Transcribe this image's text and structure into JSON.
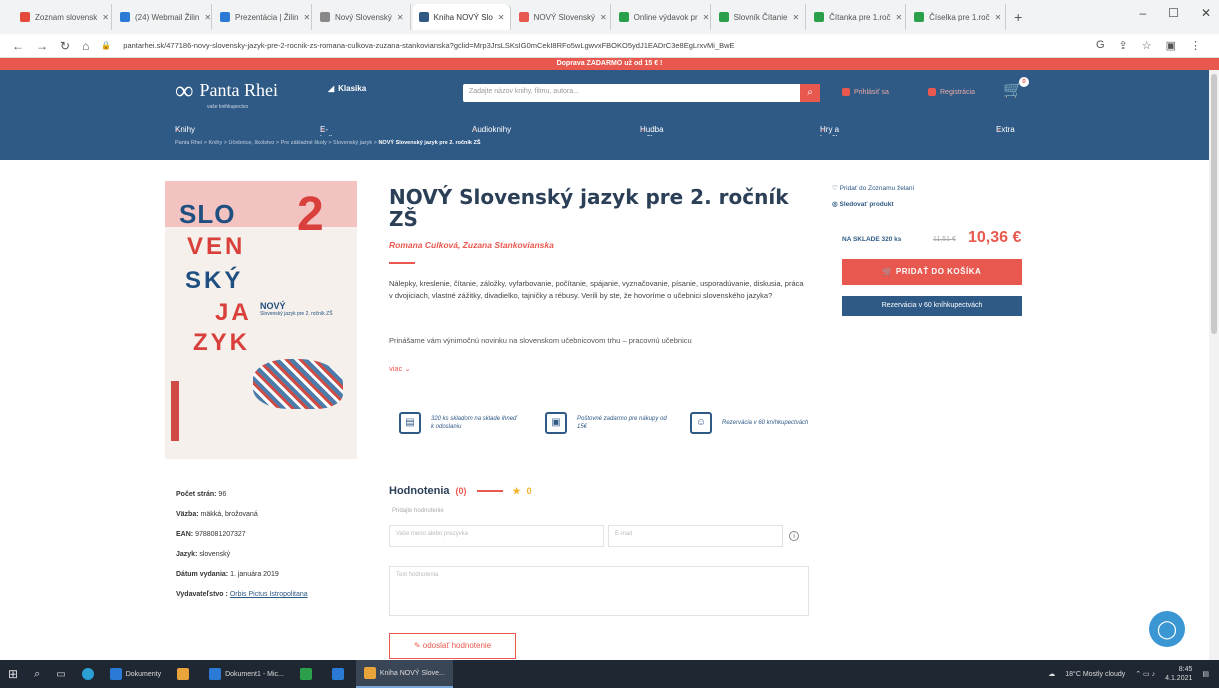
{
  "browser": {
    "tabs": [
      {
        "label": "Zoznam slovensk",
        "color": "#e44b3a"
      },
      {
        "label": "(24) Webmail Žilin",
        "color": "#2a7ad6"
      },
      {
        "label": "Prezentácia | Žilin",
        "color": "#2a7ad6"
      },
      {
        "label": "Nový Slovenský",
        "color": "#888888"
      },
      {
        "label": "Kniha NOVÝ Slo",
        "color": "#2f5a86",
        "active": true
      },
      {
        "label": "NOVÝ Slovenský",
        "color": "#e8584f"
      },
      {
        "label": "Online výdavok pr",
        "color": "#2aa04b"
      },
      {
        "label": "Slovník Čítanie",
        "color": "#2aa04b"
      },
      {
        "label": "Čítanka pre 1.roč",
        "color": "#2aa04b"
      },
      {
        "label": "Číselka pre 1.roč",
        "color": "#2aa04b"
      }
    ],
    "new_tab": "+",
    "url": "pantarhei.sk/477186-novy-slovensky-jazyk-pre-2-rocnik-zs-romana-culkova-zuzana-stankovianska?gclid=Mrp3JrsLSKsIG0mCekI8RFo5wLgwvxFBOKO5ydJ1EADrC3e8EgLrxvMi_BwE"
  },
  "promo": "Doprava ZADARMO už od 15 € !",
  "header": {
    "logo": "Panta Rhei",
    "logo_sub": "vaše knihkupectvo",
    "klasika": "Klasika",
    "search_placeholder": "Zadajte názov knihy, filmu, autora...",
    "link1": "Prihlásiť sa",
    "link2": "Registrácia",
    "cart_count": "0"
  },
  "menu": [
    "Knihy",
    "E-knihy",
    "Audioknihy",
    "Hudba a filmy",
    "Hry a hračky",
    "Extra"
  ],
  "breadcrumb": {
    "path": "Panta Rhei  >  Knihy  >  Učebnice, školstvo  >  Pre základné školy  >  Slovenský jazyk  >  ",
    "current": "NOVÝ Slovenský jazyk pre 2. ročník ZŠ"
  },
  "cover": {
    "slo": "SLO",
    "two": "2",
    "lines": [
      "VEN",
      "SKÝ",
      "JA",
      "ZYK"
    ],
    "novy": "NOVÝ",
    "novy_sub": "Slovenský jazyk pre 2. ročník ZŠ"
  },
  "product": {
    "title": "NOVÝ Slovenský jazyk pre 2. ročník ZŠ",
    "authors": "Romana Culková, Zuzana Stankovianska",
    "description": "Nálepky, kreslenie, čítanie, záložky, vyfarbovanie, počítanie, spájanie, vyznačovanie, písanie, usporadúvanie, diskusia, práca v dvojiciach, vlastné zážitky, divadielko, tajničky a rébusy. Verili by ste, že hovoríme o učebnici slovenského jazyka?",
    "description2": "Prinášame vám výnimočnú novinku na slovenskom učebnicovom trhu – pracovnú učebnicu",
    "more": "viac",
    "features": [
      {
        "icon": "book-icon",
        "glyph": "▤",
        "text": "320 ks skladom na sklade ihneď k odoslaniu"
      },
      {
        "icon": "wallet-icon",
        "glyph": "▣",
        "text": "Poštovné zadarmo pre nákupy od 15€"
      },
      {
        "icon": "person-icon",
        "glyph": "☺",
        "text": "Rezervácia v 60 kníhkupectvách"
      }
    ]
  },
  "sidebar": {
    "wishlist": "Pridať do Zoznamu želaní",
    "watch": "Sledovať produkt",
    "stock": "NA SKLADE 320 ks",
    "old_price": "11,51 €",
    "price": "10,36 €",
    "add_to_cart": "PRIDAŤ DO KOŠÍKA",
    "reserve": "Rezervácia v 60 kníhkupectvách"
  },
  "details": [
    {
      "label": "Počet strán:",
      "value": "96"
    },
    {
      "label": "Väzba:",
      "value": "mäkká, brožovaná"
    },
    {
      "label": "EAN:",
      "value": "9788081207327"
    },
    {
      "label": "Jazyk:",
      "value": "slovenský"
    },
    {
      "label": "Dátum vydania:",
      "value": "1. januára 2019"
    },
    {
      "label": "Vydavateľstvo :",
      "value": "Orbis Pictus Istropolitana"
    }
  ],
  "rating": {
    "title": "Hodnotenia",
    "count": "(0)",
    "score": "0",
    "form_label": "Pridajte hodnotenie",
    "name_placeholder": "Vaše meno alebo prezývka",
    "email_placeholder": "E-mail",
    "text_placeholder": "Text hodnotenia",
    "send": "odoslať hodnotenie"
  },
  "taskbar": {
    "items": [
      {
        "label": "Dokumenty",
        "color": "#2a7ad6"
      },
      {
        "label": "",
        "color": "#e8a33a"
      },
      {
        "label": "Dokument1 - Mic...",
        "color": "#2a7ad6"
      },
      {
        "label": "",
        "color": "#2aa04b"
      },
      {
        "label": "",
        "color": "#2a7ad6"
      },
      {
        "label": "Kniha NOVÝ Slove...",
        "color": "#e8a33a",
        "active": true
      }
    ],
    "weather": "18°C Mostly cloudy",
    "time": "8:45",
    "date": "4.1.2021"
  }
}
